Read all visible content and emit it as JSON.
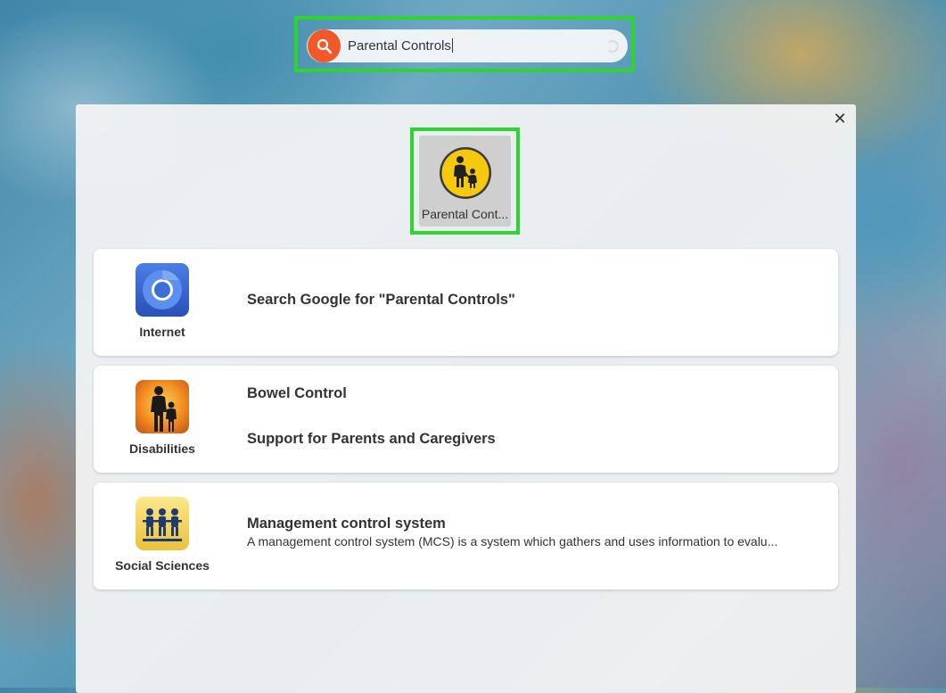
{
  "search": {
    "query": "Parental Controls"
  },
  "top_result": {
    "label": "Parental Cont...",
    "icon": "parental-controls-icon"
  },
  "results": [
    {
      "category": "Internet",
      "icon": "chromium-browser-icon",
      "lines": [
        "Search Google for \"Parental Controls\""
      ]
    },
    {
      "category": "Disabilities",
      "icon": "parent-child-silhouette-icon",
      "lines": [
        "Bowel Control",
        "Support for Parents and Caregivers"
      ]
    },
    {
      "category": "Social Sciences",
      "icon": "people-group-icon",
      "title": "Management control system",
      "description": "A management control system (MCS) is a system which gathers and uses information to evalu..."
    }
  ],
  "colors": {
    "highlight": "#2ed52e",
    "search_button": "#f2592a"
  }
}
